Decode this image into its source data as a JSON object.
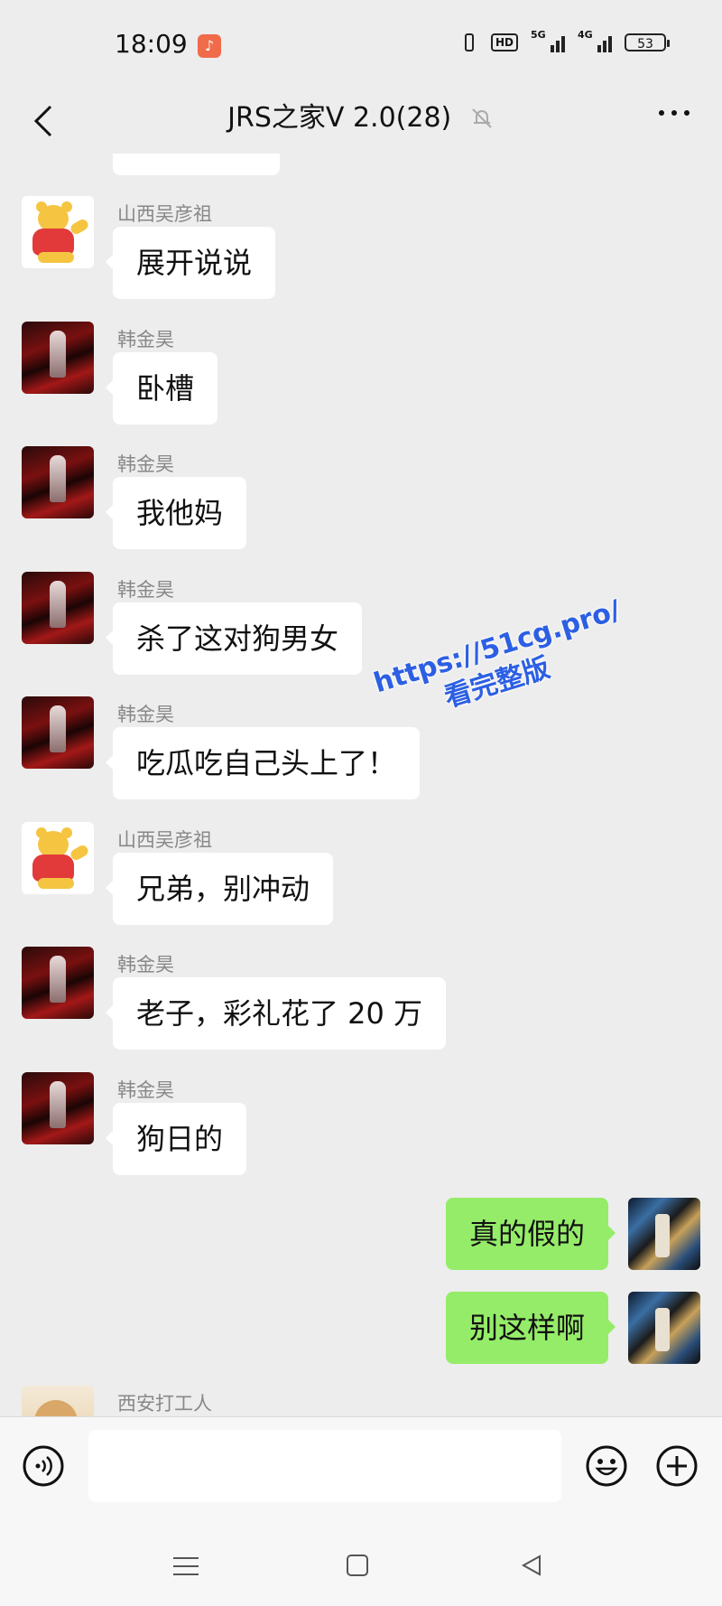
{
  "status_bar": {
    "time": "18:09",
    "hd": "HD",
    "net1": "5G",
    "net2": "4G",
    "battery": "53"
  },
  "header": {
    "title": "JRS之家V 2.0(28)"
  },
  "messages": [
    {
      "sender": "山西吴彦祖",
      "text": "展开说说"
    },
    {
      "sender": "韩金昊",
      "text": "卧槽"
    },
    {
      "sender": "韩金昊",
      "text": "我他妈"
    },
    {
      "sender": "韩金昊",
      "text": "杀了这对狗男女"
    },
    {
      "sender": "韩金昊",
      "text": "吃瓜吃自己头上了！"
    },
    {
      "sender": "山西吴彦祖",
      "text": "兄弟，别冲动"
    },
    {
      "sender": "韩金昊",
      "text": "老子，彩礼花了 20 万"
    },
    {
      "sender": "韩金昊",
      "text": "狗日的"
    },
    {
      "sender": "me",
      "text": "真的假的"
    },
    {
      "sender": "me",
      "text": "别这样啊"
    },
    {
      "sender": "西安打工人",
      "text": ""
    }
  ],
  "watermark": {
    "line1": "https://51cg.pro/",
    "line2": "看完整版"
  },
  "input": {
    "placeholder": ""
  },
  "colors": {
    "background": "#ededed",
    "self_bubble": "#95ec69",
    "watermark": "#2c5fe3"
  }
}
